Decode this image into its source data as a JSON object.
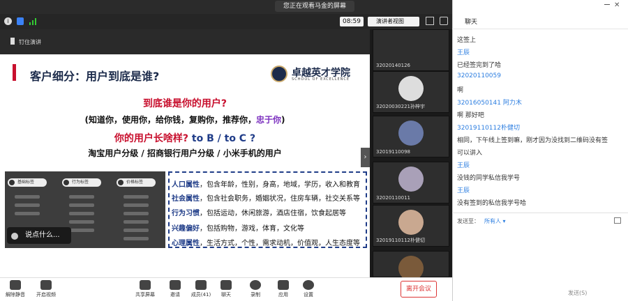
{
  "banner": {
    "viewing": "您正在观看马金的屏幕"
  },
  "info": {
    "timer": "08:59",
    "view_mode": "演讲者视图"
  },
  "slide": {
    "sticker": "钉住演讲",
    "title": "客户细分：用户到底是谁?",
    "logo_name": "卓越英才学院",
    "logo_sub": "SCHOOL OF EXCELLENCE",
    "q1": "到底谁是你的用户?",
    "q2_pre": "(知道你，使用你，给你钱，复购你，推荐你，",
    "q2_hl": "忠于你",
    "q2_post": ")",
    "q3_pre": "你的用户长啥样?",
    "q3_post": " to B / to C ?",
    "q4": "淘宝用户分级 / 招商银行用户分级 / 小米手机的用户",
    "pills": [
      "基础标签",
      "行为标签",
      "价格标签"
    ],
    "caption": "说点什么...",
    "attributes": [
      {
        "label": "人口属性",
        "text": "，包含年龄，性别，身高，地域，学历，收入和教育"
      },
      {
        "label": "社会属性",
        "text": "，包含社会职务，婚姻状况，住房车辆，社交关系等"
      },
      {
        "label": "行为习惯",
        "text": "，包括运动，休闲旅游，酒店住宿，饮食起居等"
      },
      {
        "label": "兴趣偏好",
        "text": "，包括购物，游戏，体育，文化等"
      },
      {
        "label": "心理属性",
        "text": "，生活方式，个性，需求动机，价值观，人生态度等"
      }
    ]
  },
  "thumbnails": [
    "32020140126",
    "32020030221孙梓宇",
    "32019110098",
    "32020110011",
    "32019110112朴健切",
    ""
  ],
  "toolbar": {
    "mute": "解除静音",
    "video": "开启视频",
    "share": "共享屏幕",
    "invite": "邀请",
    "members": "成员(41)",
    "chat": "聊天",
    "record": "录制",
    "apps": "应用",
    "settings": "设置",
    "leave": "离开会议"
  },
  "chat": {
    "title": "聊天",
    "messages": [
      {
        "type": "t",
        "text": "这签上"
      },
      {
        "type": "n",
        "text": "王辰"
      },
      {
        "type": "t",
        "text": "已经签完到了哈"
      },
      {
        "type": "n",
        "text": "32020110059"
      },
      {
        "type": "t",
        "text": "啊"
      },
      {
        "type": "n",
        "text": "32016050141 阿力木"
      },
      {
        "type": "t",
        "text": "啊 那好吧"
      },
      {
        "type": "n",
        "text": "32019110112朴健切"
      },
      {
        "type": "t",
        "text": "相同，下午线上签到嘛，刚才因为没找到二维码没有签"
      },
      {
        "type": "t",
        "text": "可以讲入"
      },
      {
        "type": "n",
        "text": "王辰"
      },
      {
        "type": "t",
        "text": "没钱的同学私信我学号"
      },
      {
        "type": "n",
        "text": "王辰"
      },
      {
        "type": "t",
        "text": "没有签到的私信我学号哈"
      }
    ],
    "send_to_label": "发送至：",
    "send_to_value": "所有人 ▾",
    "send_button": "发送(S)"
  }
}
